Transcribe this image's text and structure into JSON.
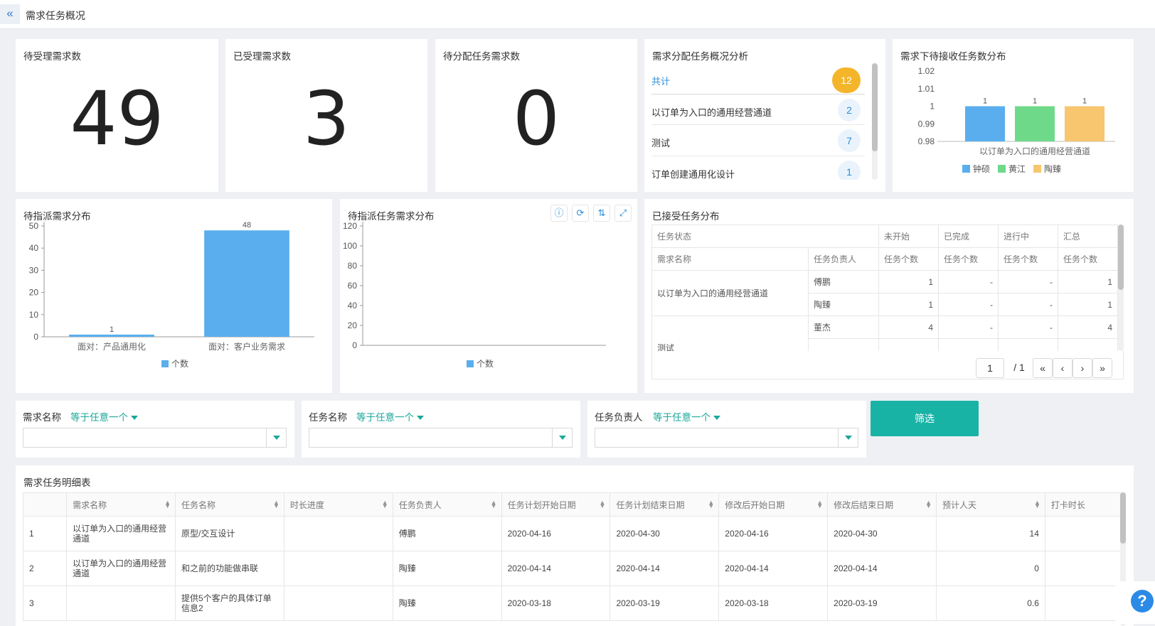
{
  "header": {
    "collapse_icon": "«",
    "title": "需求任务概况"
  },
  "kpis": [
    {
      "title": "待受理需求数",
      "value": "49"
    },
    {
      "title": "已受理需求数",
      "value": "3"
    },
    {
      "title": "待分配任务需求数",
      "value": "0"
    }
  ],
  "assign_analysis": {
    "title": "需求分配任务概况分析",
    "rows": [
      {
        "label": "共计",
        "count": "12"
      },
      {
        "label": "以订单为入口的通用经营通道",
        "count": "2"
      },
      {
        "label": "测试",
        "count": "7"
      },
      {
        "label": "订单创建通用化设计",
        "count": "1"
      }
    ]
  },
  "pending_receive": {
    "title": "需求下待接收任务数分布",
    "chart_data": {
      "type": "bar",
      "categories": [
        "以订单为入口的通用经营通道"
      ],
      "series": [
        {
          "name": "钟硕",
          "values": [
            1
          ],
          "color": "#5aaeee"
        },
        {
          "name": "黄江",
          "values": [
            1
          ],
          "color": "#6fd98a"
        },
        {
          "name": "陶臻",
          "values": [
            1
          ],
          "color": "#f8c66f"
        }
      ],
      "ylim": [
        0.98,
        1.02
      ],
      "y_ticks": [
        "1.02",
        "1.01",
        "1",
        "0.99",
        "0.98"
      ],
      "legend": "bottom"
    }
  },
  "assign_dist": {
    "title": "待指派需求分布",
    "chart_data": {
      "type": "bar",
      "categories": [
        "面对：产品通用化",
        "面对：客户业务需求"
      ],
      "series": [
        {
          "name": "个数",
          "values": [
            1,
            48
          ],
          "color": "#5aaeee"
        }
      ],
      "ylim": [
        0,
        50
      ],
      "y_ticks": [
        "50",
        "40",
        "30",
        "20",
        "10",
        "0"
      ],
      "legend": "bottom"
    }
  },
  "assign_task_dist": {
    "title": "待指派任务需求分布",
    "chart_data": {
      "type": "bar",
      "categories": [],
      "series": [
        {
          "name": "个数",
          "values": [],
          "color": "#5aaeee"
        }
      ],
      "ylim": [
        0,
        120
      ],
      "y_ticks": [
        "120",
        "100",
        "80",
        "60",
        "40",
        "20",
        "0"
      ],
      "legend": "bottom"
    }
  },
  "accepted_dist": {
    "title": "已接受任务分布",
    "header_row1": {
      "status_label": "任务状态",
      "cols": [
        "未开始",
        "已完成",
        "进行中",
        "汇总"
      ]
    },
    "header_row2": {
      "req_label": "需求名称",
      "owner_label": "任务负责人",
      "count_label": "任务个数"
    },
    "rows": [
      {
        "req": "以订单为入口的通用经营通道",
        "owner": "傅鹏",
        "vals": [
          "1",
          "-",
          "-",
          "1"
        ]
      },
      {
        "req": "",
        "owner": "陶臻",
        "vals": [
          "1",
          "-",
          "-",
          "1"
        ]
      },
      {
        "req": "测试",
        "owner": "董杰",
        "vals": [
          "4",
          "-",
          "-",
          "4"
        ]
      }
    ],
    "pager": {
      "page": "1",
      "total": "/ 1",
      "first": "«",
      "prev": "‹",
      "next": "›",
      "last": "»"
    }
  },
  "filters": [
    {
      "label": "需求名称",
      "op": "等于任意一个",
      "value": ""
    },
    {
      "label": "任务名称",
      "op": "等于任意一个",
      "value": ""
    },
    {
      "label": "任务负责人",
      "op": "等于任意一个",
      "value": ""
    }
  ],
  "filter_button": "筛选",
  "detail": {
    "title": "需求任务明细表",
    "columns": [
      "",
      "需求名称",
      "任务名称",
      "时长进度",
      "任务负责人",
      "任务计划开始日期",
      "任务计划结束日期",
      "修改后开始日期",
      "修改后结束日期",
      "预计人天",
      "打卡时长"
    ],
    "rows": [
      [
        "1",
        "以订单为入口的通用经营通道",
        "原型/交互设计",
        "",
        "傅鹏",
        "2020-04-16",
        "2020-04-30",
        "2020-04-16",
        "2020-04-30",
        "14",
        ""
      ],
      [
        "2",
        "以订单为入口的通用经营通道",
        "和之前的功能做串联",
        "",
        "陶臻",
        "2020-04-14",
        "2020-04-14",
        "2020-04-14",
        "2020-04-14",
        "0",
        ""
      ],
      [
        "3",
        "",
        "提供5个客户的具体订单信息2",
        "",
        "陶臻",
        "2020-03-18",
        "2020-03-19",
        "2020-03-18",
        "2020-03-19",
        "0.6",
        ""
      ]
    ]
  },
  "help_icon": "?"
}
